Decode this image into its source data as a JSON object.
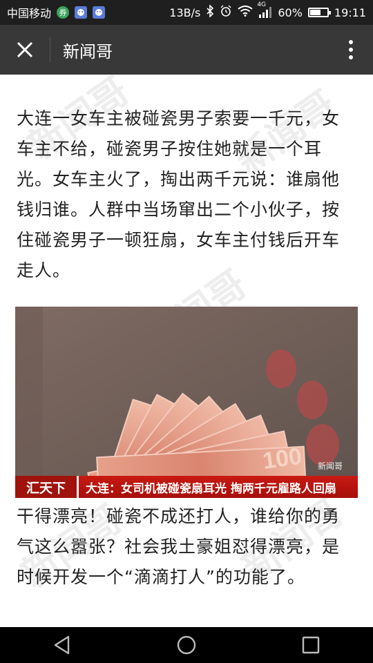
{
  "status_bar": {
    "carrier": "中国移动",
    "ticket_badge": "券",
    "network_speed": "13B/s",
    "network_type": "4G",
    "battery": "60%",
    "battery_level": 0.6,
    "time": "19:11"
  },
  "app_bar": {
    "title": "新闻哥",
    "close_icon": "close-icon",
    "more_icon": "more-vertical-icon"
  },
  "article": {
    "paragraph1": "大连一女车主被碰瓷男子索要一千元，女车主不给，碰瓷男子按住她就是一个耳光。女车主火了，掏出两千元说：谁扇他钱归谁。人群中当场窜出二个小伙子，按住碰瓷男子一顿狂扇，女车主付钱后开车走人。",
    "image": {
      "channel": "汇天下",
      "headline": "大连：女司机被碰瓷扇耳光  掏两千元雇路人回扇",
      "watermark": "新闻哥"
    },
    "paragraph2": "干得漂亮！碰瓷不成还打人，谁给你的勇气这么嚣张？社会我土豪姐怼得漂亮，是时候开发一个“滴滴打人”的功能了。"
  },
  "nav_bar": {
    "back_icon": "back-triangle-icon",
    "home_icon": "home-circle-icon",
    "recents_icon": "recents-square-icon"
  },
  "colors": {
    "status_bar_bg": "#1f1f1f",
    "app_bar_bg": "#383838",
    "caption_red": "#c81a12"
  }
}
